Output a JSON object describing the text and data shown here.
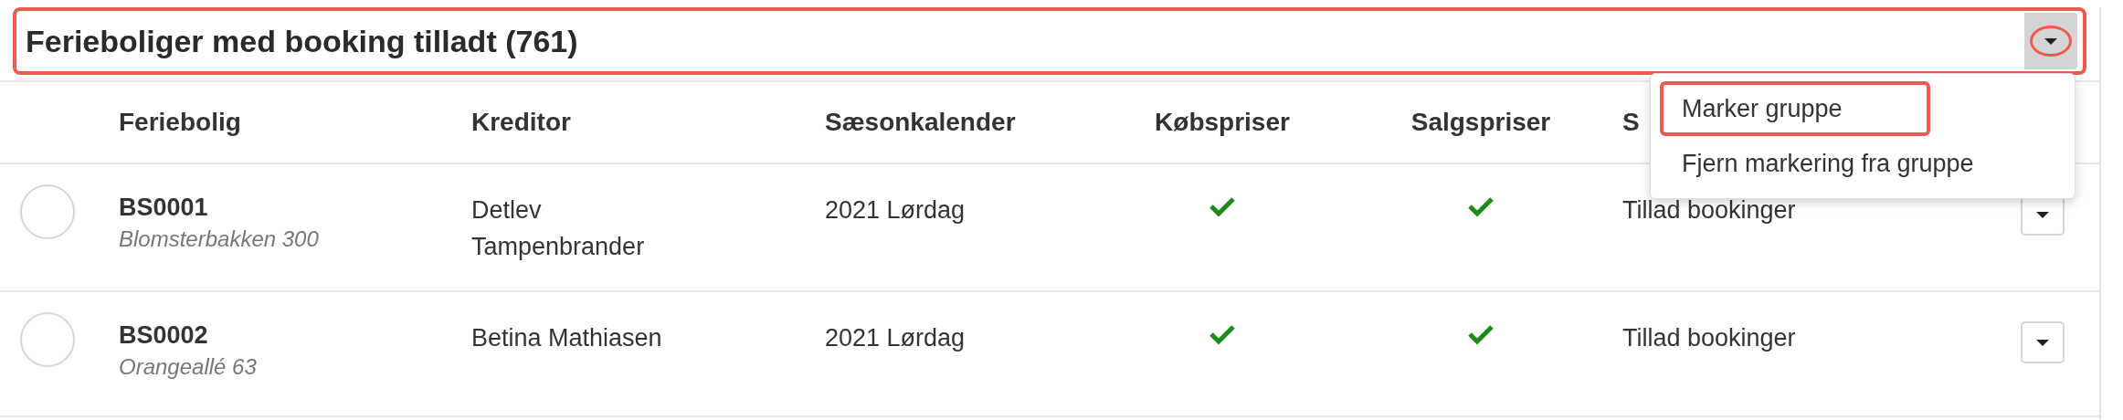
{
  "group_header": {
    "title": "Ferieboliger med booking tilladt (761)",
    "highlighted": true,
    "toggle_highlighted": true
  },
  "menu": {
    "items": [
      {
        "label": "Marker gruppe",
        "highlighted": true
      },
      {
        "label": "Fjern markering fra gruppe",
        "highlighted": false
      }
    ]
  },
  "table": {
    "columns": [
      "Feriebolig",
      "Kreditor",
      "Sæsonkalender",
      "Købspriser",
      "Salgspriser",
      "S"
    ],
    "rows": [
      {
        "selected": false,
        "code": "BS0001",
        "address": "Blomsterbakken 300",
        "creditor": "Detlev Tampenbrander",
        "calendar": "2021 Lørdag",
        "purchase_prices": true,
        "sales_prices": true,
        "status": "Tillad bookinger"
      },
      {
        "selected": false,
        "code": "BS0002",
        "address": "Orangeallé 63",
        "creditor": "Betina Mathiasen",
        "calendar": "2021 Lørdag",
        "purchase_prices": true,
        "sales_prices": true,
        "status": "Tillad bookinger"
      }
    ]
  }
}
